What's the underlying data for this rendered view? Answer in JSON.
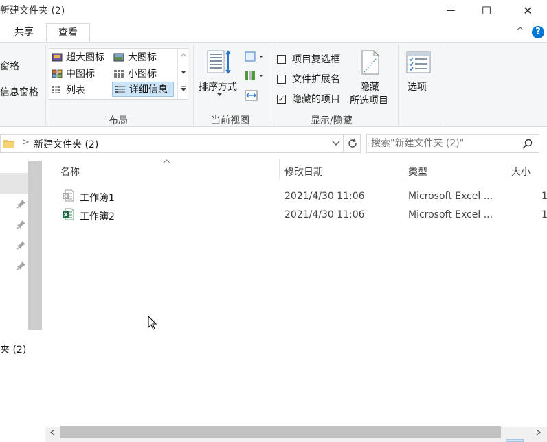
{
  "window": {
    "title": "新建文件夹 (2)",
    "minimize_glyph": "—",
    "maximize_glyph": "☐",
    "close_glyph": "✕"
  },
  "ribbon_tabs": [
    "共享",
    "查看"
  ],
  "ribbon": {
    "collapse_glyph": "^",
    "help_glyph": "?",
    "pane_group": {
      "item1": "窗格",
      "item2": "信息窗格"
    },
    "layout": {
      "items": [
        "超大图标",
        "大图标",
        "中图标",
        "小图标",
        "列表",
        "详细信息"
      ],
      "selected": "详细信息",
      "group_label": "布局"
    },
    "current_view": {
      "sort_label": "排序方式",
      "group_label": "当前视图"
    },
    "show_hide": {
      "checkboxes": [
        {
          "label": "项目复选框",
          "checked": false
        },
        {
          "label": "文件扩展名",
          "checked": false
        },
        {
          "label": "隐藏的项目",
          "checked": true
        }
      ],
      "hide_selected_line1": "隐藏",
      "hide_selected_line2": "所选项目",
      "group_label": "显示/隐藏"
    },
    "options_label": "选项"
  },
  "address_bar": {
    "path": "新建文件夹 (2)",
    "separator": ">",
    "search_placeholder": "搜索\"新建文件夹 (2)\""
  },
  "nav_pane": {
    "bottom_label": "夹 (2)"
  },
  "columns": [
    "名称",
    "修改日期",
    "类型",
    "大小"
  ],
  "files": [
    {
      "name": "工作簿1",
      "modified": "2021/4/30 11:06",
      "type": "Microsoft Excel ...",
      "size": "1"
    },
    {
      "name": "工作簿2",
      "modified": "2021/4/30 11:06",
      "type": "Microsoft Excel ...",
      "size": "1"
    }
  ],
  "colors": {
    "accent": "#0078d7",
    "excel_green": "#1e7145",
    "selection": "#cce4f7"
  }
}
